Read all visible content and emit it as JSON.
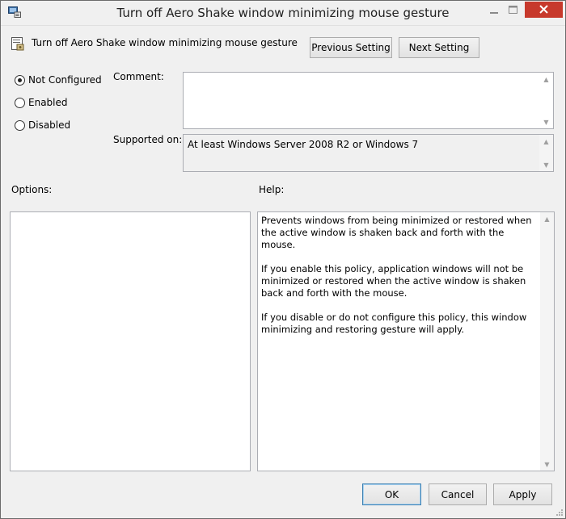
{
  "window": {
    "title": "Turn off Aero Shake window minimizing mouse gesture",
    "icon": "group-policy-editor-icon"
  },
  "header": {
    "policy_name": "Turn off Aero Shake window minimizing mouse gesture",
    "policy_icon": "policy-setting-icon",
    "previous_label": "Previous Setting",
    "next_label": "Next Setting"
  },
  "state": {
    "options": [
      {
        "label": "Not Configured",
        "checked": true
      },
      {
        "label": "Enabled",
        "checked": false
      },
      {
        "label": "Disabled",
        "checked": false
      }
    ]
  },
  "comment": {
    "label": "Comment:",
    "value": ""
  },
  "supported": {
    "label": "Supported on:",
    "value": "At least Windows Server 2008 R2 or Windows 7"
  },
  "options_label": "Options:",
  "help_label": "Help:",
  "help": {
    "paragraphs": [
      "Prevents windows from being minimized or restored when the active window is shaken back and forth with the mouse.",
      "If you enable this policy, application windows will not be minimized or restored when the active window is shaken back and forth with the mouse.",
      "If you disable or do not configure this policy, this window minimizing and restoring gesture will apply."
    ]
  },
  "footer": {
    "ok_label": "OK",
    "cancel_label": "Cancel",
    "apply_label": "Apply"
  },
  "colors": {
    "close_button": "#c7392c",
    "default_button_border": "#3c7fb1"
  }
}
